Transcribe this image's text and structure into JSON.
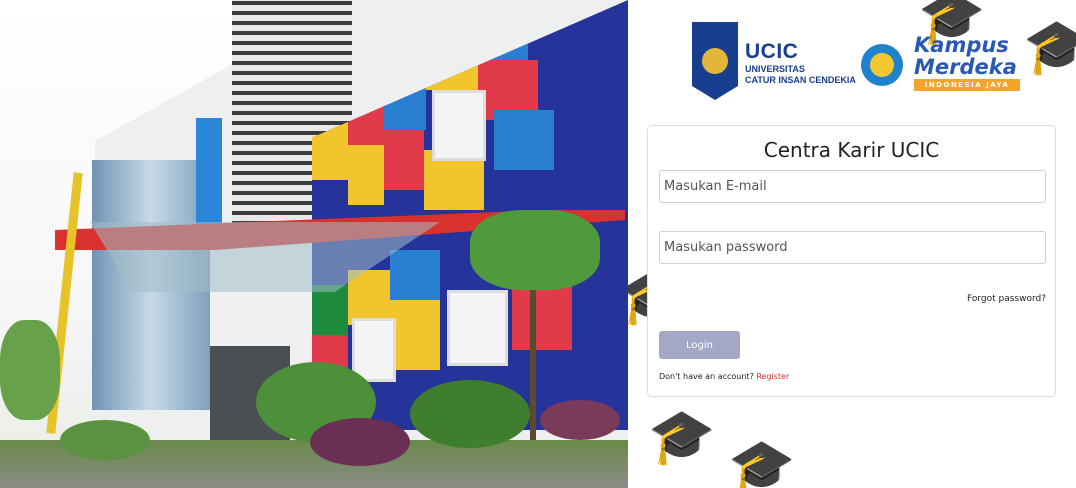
{
  "branding": {
    "ucic_title": "UCIC",
    "ucic_subtitle_line1": "UNIVERSITAS",
    "ucic_subtitle_line2": "CATUR INSAN CENDEKIA",
    "km_line1": "Kampus",
    "km_line2": "Merdeka",
    "km_band": "INDONESIA JAYA"
  },
  "login": {
    "title": "Centra Karir UCIC",
    "email_placeholder": "Masukan E-mail",
    "email_value": "",
    "password_placeholder": "Masukan password",
    "password_value": "",
    "forgot_label": "Forgot password?",
    "login_label": "Login",
    "no_account_text": "Don't have an account?",
    "register_label": "Register"
  },
  "colors": {
    "ucic_blue": "#173f8f",
    "login_button": "#a5a7c6",
    "register_link": "#d33131"
  },
  "icons": {
    "ucic_logo": "ucic-shield-logo",
    "kampus_merdeka_logo": "kampus-merdeka-logo",
    "background_decoration": "graduation-cap-icon"
  }
}
